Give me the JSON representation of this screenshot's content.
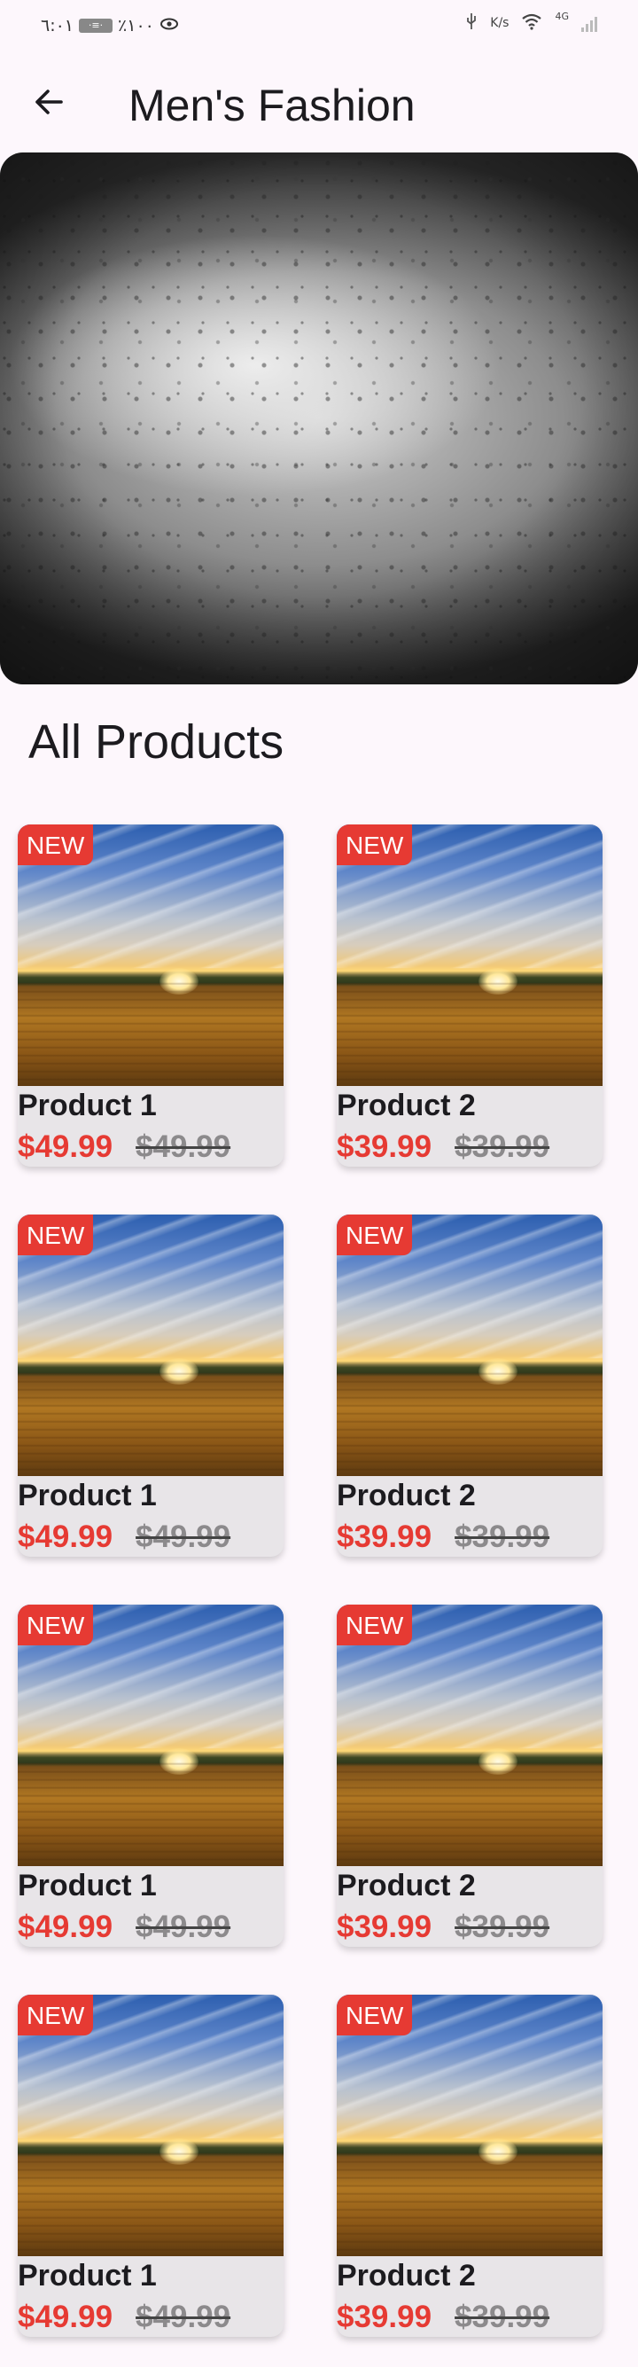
{
  "status_bar": {
    "time": "٦:٠١",
    "sim_label": "·≡·",
    "battery": "٪١٠٠",
    "speed_unit": "K/s",
    "network": "4G"
  },
  "app_bar": {
    "title": "Men's Fashion",
    "back_icon": "arrow-left-icon"
  },
  "section": {
    "title": "All Products"
  },
  "products": [
    {
      "badge": "NEW",
      "name": "Product 1",
      "price": "$49.99",
      "old_price": "$49.99"
    },
    {
      "badge": "NEW",
      "name": "Product 2",
      "price": "$39.99",
      "old_price": "$39.99"
    },
    {
      "badge": "NEW",
      "name": "Product 1",
      "price": "$49.99",
      "old_price": "$49.99"
    },
    {
      "badge": "NEW",
      "name": "Product 2",
      "price": "$39.99",
      "old_price": "$39.99"
    },
    {
      "badge": "NEW",
      "name": "Product 1",
      "price": "$49.99",
      "old_price": "$49.99"
    },
    {
      "badge": "NEW",
      "name": "Product 2",
      "price": "$39.99",
      "old_price": "$39.99"
    },
    {
      "badge": "NEW",
      "name": "Product 1",
      "price": "$49.99",
      "old_price": "$49.99"
    },
    {
      "badge": "NEW",
      "name": "Product 2",
      "price": "$39.99",
      "old_price": "$39.99"
    }
  ],
  "colors": {
    "background": "#fdf7fc",
    "accent_red": "#e63a33",
    "card_bg": "#e8e5e8",
    "old_price_gray": "#8c8a8c"
  }
}
